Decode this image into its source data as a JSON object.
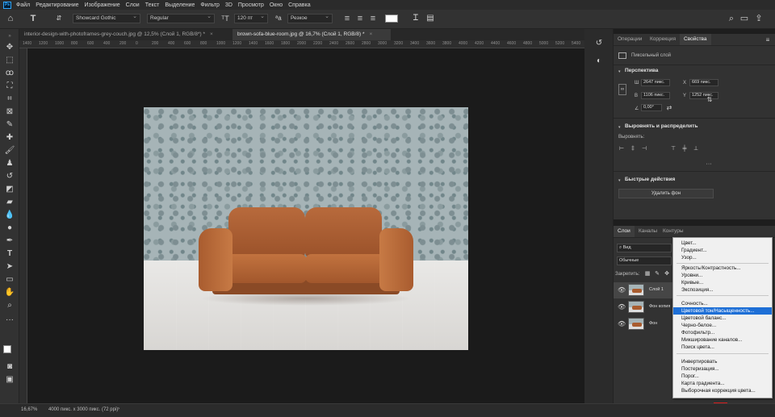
{
  "menubar": {
    "app_logo": "Ps",
    "items": [
      "Файл",
      "Редактирование",
      "Изображение",
      "Слои",
      "Текст",
      "Выделение",
      "Фильтр",
      "3D",
      "Просмотр",
      "Окно",
      "Справка"
    ]
  },
  "options": {
    "font_family": "Showcard Gothic",
    "font_style": "Regular",
    "font_size": "120 пт",
    "antialias": "Резкое"
  },
  "tabs": [
    {
      "label": "interior-design-with-photoframes-grey-couch.jpg @ 12,5% (Слой 1, RGB/8*) *",
      "close": "×"
    },
    {
      "label": "brown-sofa-blue-room.jpg @ 16,7% (Слой 1, RGB/8) *",
      "close": "×"
    }
  ],
  "ruler": [
    "1400",
    "1200",
    "1000",
    "800",
    "600",
    "400",
    "200",
    "0",
    "200",
    "400",
    "600",
    "800",
    "1000",
    "1200",
    "1400",
    "1600",
    "1800",
    "2000",
    "2200",
    "2400",
    "2600",
    "2800",
    "3000",
    "3200",
    "3400",
    "3600",
    "3800",
    "4000",
    "4200",
    "4400",
    "4600",
    "4800",
    "5000",
    "5200",
    "5400"
  ],
  "status": {
    "zoom": "16,67%",
    "doc_info": "4000 пикс. x 3000 пикс. (72 ppi)"
  },
  "properties": {
    "tabs": [
      "Операции",
      "Коррекция",
      "Свойства"
    ],
    "layer_type": "Пиксельный слой",
    "transform_head": "Перспектива",
    "w_label": "Ш",
    "w_value": "2647 пикс.",
    "h_label": "В",
    "h_value": "1106 пикс.",
    "x_label": "X",
    "x_value": "669 пикс.",
    "y_label": "Y",
    "y_value": "1252 пикс.",
    "angle_value": "0,00°",
    "align_head": "Выровнять и распределить",
    "align_label": "Выровнять:",
    "quick_head": "Быстрые действия",
    "remove_bg": "Удалить фон"
  },
  "layers": {
    "tabs": [
      "Слои",
      "Каналы",
      "Контуры"
    ],
    "filter": "Вид",
    "blend": "Обычные",
    "lock_label": "Закрепить:",
    "items": [
      "Слой 1",
      "Фон копия",
      "Фон"
    ]
  },
  "adjust_menu": {
    "items": [
      "Цвет...",
      "Градиент...",
      "Узор...",
      "Яркость/Контрастность...",
      "Уровни...",
      "Кривые...",
      "Экспозиция...",
      "Сочность...",
      "Цветовой тон/Насыщенность...",
      "Цветовой баланс...",
      "Черно-белое...",
      "Фотофильтр...",
      "Микширование каналов...",
      "Поиск цвета...",
      "Инвертировать",
      "Постеризация...",
      "Порог...",
      "Карта градиента...",
      "Выборочная коррекция цвета..."
    ],
    "highlighted": "Цветовой тон/Насыщенность..."
  }
}
